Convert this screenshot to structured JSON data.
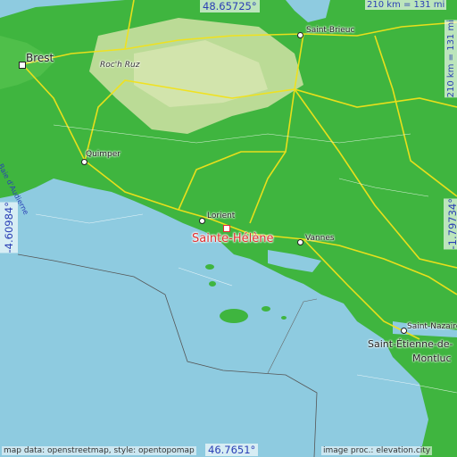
{
  "map": {
    "place": "Sainte-Hélène",
    "coords": {
      "top": "48.65725°",
      "bottom": "46.7651°",
      "left": "-4.60984°",
      "right": "-1.79734°"
    },
    "scale": {
      "horizontal": "210 km = 131 mi",
      "vertical": "210 km = 131 mi"
    },
    "cities": [
      {
        "name": "Brest"
      },
      {
        "name": "Saint-Brieuc"
      },
      {
        "name": "Roc'h Ruz"
      },
      {
        "name": "Quimper"
      },
      {
        "name": "Lorient"
      },
      {
        "name": "Vannes"
      },
      {
        "name": "Saint-Nazaire"
      },
      {
        "name": "Saint-Étienne-de-"
      },
      {
        "name": "Montluc"
      }
    ],
    "river": "Baie d'Audierne",
    "footer": {
      "left": "map data: openstreetmap, style: opentopomap",
      "right": "image proc.: elevation.city"
    },
    "colors": {
      "sea": "#8ecbe0",
      "lowland": "#3fb53f",
      "upland": "#c9dfa0",
      "highlight": "#e03030",
      "coord_text": "#2a3fb5"
    }
  }
}
